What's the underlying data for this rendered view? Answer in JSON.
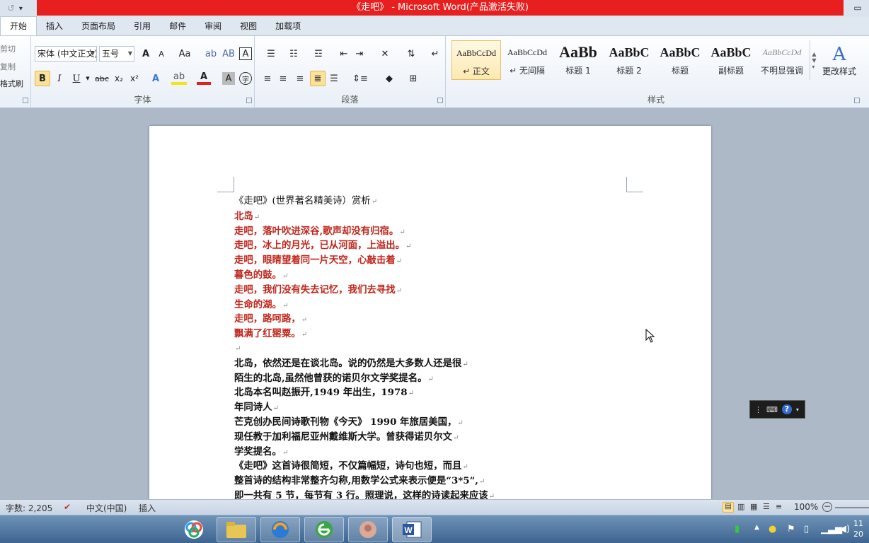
{
  "window": {
    "title": "《走吧》 - Microsoft Word(产品激活失败)",
    "minimize_glyph": "▭",
    "qat": {
      "undo_glyph": "↺",
      "customize_glyph": "▾"
    }
  },
  "tabs": [
    "开始",
    "插入",
    "页面布局",
    "引用",
    "邮件",
    "审阅",
    "视图",
    "加载项"
  ],
  "ribbon": {
    "clipboard": {
      "cut": "剪切",
      "copy": "复制",
      "format_painter": "格式刷"
    },
    "font": {
      "label": "字体",
      "font_name": "宋体 (中文正文)",
      "font_size": "五号",
      "grow": "A",
      "shrink": "A",
      "change_case": "Aa",
      "bold": "B",
      "italic": "I",
      "underline": "U",
      "strike": "abc",
      "subscript": "x₂",
      "superscript": "x²",
      "text_effects": "A",
      "highlight": "ab",
      "font_color": "A",
      "char_shading": "A",
      "enclose": "字"
    },
    "paragraph": {
      "label": "段落"
    },
    "styles": {
      "label": "样式",
      "items": [
        {
          "sample": "AaBbCcDd",
          "name": "↵ 正文"
        },
        {
          "sample": "AaBbCcDd",
          "name": "↵ 无间隔"
        },
        {
          "sample": "AaBb",
          "name": "标题 1"
        },
        {
          "sample": "AaBbC",
          "name": "标题 2"
        },
        {
          "sample": "AaBbC",
          "name": "标题"
        },
        {
          "sample": "AaBbC",
          "name": "副标题"
        },
        {
          "sample": "AaBbCcDd",
          "name": "不明显强调"
        }
      ],
      "change_styles": "更改样式"
    }
  },
  "document": {
    "lines": [
      {
        "text": "《走吧》(世界著名精美诗）赏析",
        "style": "norm"
      },
      {
        "text": "北岛",
        "style": "red"
      },
      {
        "text": "走吧，落叶吹进深谷,歌声却没有归宿。",
        "style": "red"
      },
      {
        "text": "走吧，冰上的月光，已从河面，上溢出。",
        "style": "red"
      },
      {
        "text": "走吧，眼睛望着同一片天空，心敲击着",
        "style": "red"
      },
      {
        "text": "暮色的鼓。",
        "style": "red"
      },
      {
        "text": "走吧，我们没有失去记忆，我们去寻找",
        "style": "red"
      },
      {
        "text": "生命的湖。",
        "style": "red"
      },
      {
        "text": "走吧，路呵路，",
        "style": "red"
      },
      {
        "text": "飘满了红罂粟。",
        "style": "red"
      },
      {
        "text": "",
        "style": "norm"
      },
      {
        "text": "北岛，依然还是在谈北岛。说的仍然是大多数人还是很",
        "style": "blk"
      },
      {
        "text": "陌生的北岛,虽然他曾获的诺贝尔文学奖提名。",
        "style": "blk"
      },
      {
        "text": "北岛本名叫赵振开,1949 年出生，1978",
        "style": "blk"
      },
      {
        "text": "年同诗人",
        "style": "blk"
      },
      {
        "text": "芒克创办民间诗歌刊物《今天》 1990 年旅居美国，",
        "style": "blk"
      },
      {
        "text": "现任教于加利福尼亚州戴维斯大学。曾获得诺贝尔文",
        "style": "blk"
      },
      {
        "text": "学奖提名。",
        "style": "blk"
      },
      {
        "text": "《走吧》这首诗很简短，不仅篇幅短，诗句也短，而且",
        "style": "blk"
      },
      {
        "text": "整首诗的结构非常整齐匀称,用数学公式来表示便是“3*5”,",
        "style": "blk"
      },
      {
        "text": "即一共有 5 节，每节有 3 行。照理说，这样的诗读起来应该",
        "style": "blk"
      }
    ],
    "para_mark": "↵"
  },
  "status": {
    "word_count": "字数: 2,205",
    "language": "中文(中国)",
    "insert_mode": "插入",
    "zoom": "100%"
  },
  "taskbar": {
    "clock_line1": "11",
    "clock_line2": "20"
  }
}
